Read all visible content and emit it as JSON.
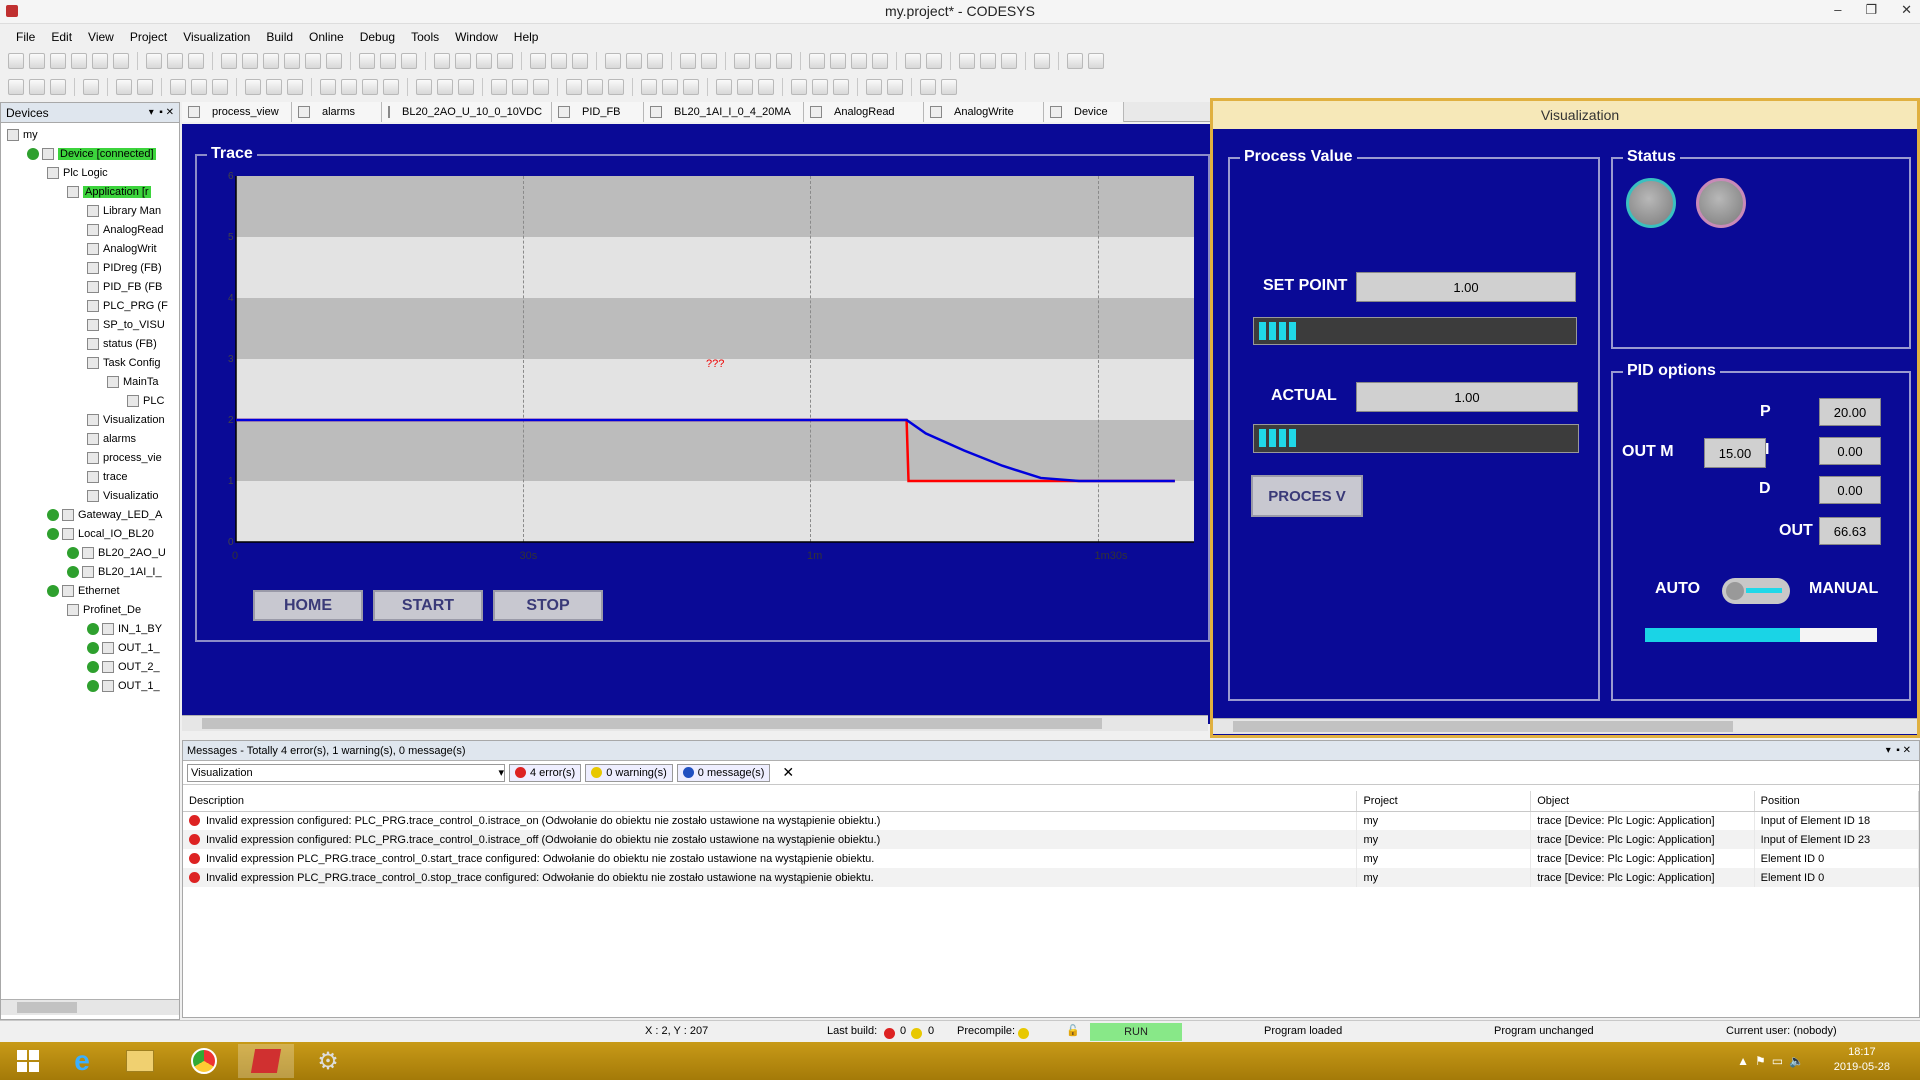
{
  "window": {
    "title": "my.project* - CODESYS"
  },
  "menu": [
    "File",
    "Edit",
    "View",
    "Project",
    "Visualization",
    "Build",
    "Online",
    "Debug",
    "Tools",
    "Window",
    "Help"
  ],
  "devices": {
    "header": "Devices",
    "tree": [
      {
        "label": "my",
        "indent": 0
      },
      {
        "label": "Device [connected]",
        "indent": 1,
        "hl": true,
        "ok": true
      },
      {
        "label": "Plc Logic",
        "indent": 2
      },
      {
        "label": "Application [r",
        "indent": 3,
        "hl": true
      },
      {
        "label": "Library Man",
        "indent": 4
      },
      {
        "label": "AnalogRead",
        "indent": 4
      },
      {
        "label": "AnalogWrit",
        "indent": 4
      },
      {
        "label": "PIDreg (FB)",
        "indent": 4
      },
      {
        "label": "PID_FB (FB",
        "indent": 4
      },
      {
        "label": "PLC_PRG (F",
        "indent": 4
      },
      {
        "label": "SP_to_VISU",
        "indent": 4
      },
      {
        "label": "status (FB)",
        "indent": 4
      },
      {
        "label": "Task Config",
        "indent": 4
      },
      {
        "label": "MainTa",
        "indent": 5
      },
      {
        "label": "PLC",
        "indent": 6
      },
      {
        "label": "Visualization",
        "indent": 4
      },
      {
        "label": "alarms",
        "indent": 4
      },
      {
        "label": "process_vie",
        "indent": 4
      },
      {
        "label": "trace",
        "indent": 4
      },
      {
        "label": "Visualizatio",
        "indent": 4
      },
      {
        "label": "Gateway_LED_A",
        "indent": 2,
        "ok": true
      },
      {
        "label": "Local_IO_BL20",
        "indent": 2,
        "ok": true
      },
      {
        "label": "BL20_2AO_U",
        "indent": 3,
        "ok": true
      },
      {
        "label": "BL20_1AI_I_",
        "indent": 3,
        "ok": true
      },
      {
        "label": "Ethernet",
        "indent": 2,
        "ok": true
      },
      {
        "label": "Profinet_De",
        "indent": 3
      },
      {
        "label": "IN_1_BY",
        "indent": 4,
        "ok": true
      },
      {
        "label": "OUT_1_",
        "indent": 4,
        "ok": true
      },
      {
        "label": "OUT_2_",
        "indent": 4,
        "ok": true
      },
      {
        "label": "OUT_1_",
        "indent": 4,
        "ok": true
      }
    ]
  },
  "tabs": [
    "process_view",
    "alarms",
    "BL20_2AO_U_10_0_10VDC",
    "PID_FB",
    "BL20_1AI_I_0_4_20MA",
    "AnalogRead",
    "AnalogWrite",
    "Device"
  ],
  "trace": {
    "title": "Trace",
    "annotation": "???",
    "buttons": {
      "home": "HOME",
      "start": "START",
      "stop": "STOP"
    }
  },
  "chart_data": {
    "type": "line",
    "x_ticks": [
      "0",
      "30s",
      "1m",
      "1m30s"
    ],
    "xlim": [
      0,
      100
    ],
    "ylim": [
      0,
      6
    ],
    "y_ticks": [
      "0",
      "1",
      "2",
      "3",
      "4",
      "5",
      "6"
    ],
    "series": [
      {
        "color": "#ff0000",
        "x": [
          0,
          70,
          70.2,
          98
        ],
        "y": [
          2,
          2,
          1,
          1
        ]
      },
      {
        "color": "#0000dd",
        "x": [
          0,
          70,
          72,
          76,
          80,
          84,
          88,
          98
        ],
        "y": [
          2,
          2,
          1.78,
          1.5,
          1.25,
          1.05,
          1,
          1
        ]
      }
    ]
  },
  "visualization": {
    "title": "Visualization",
    "process_value": {
      "title": "Process Value",
      "setpoint_label": "SET POINT",
      "setpoint_value": "1.00",
      "actual_label": "ACTUAL",
      "actual_value": "1.00",
      "button": "PROCES V"
    },
    "status": {
      "title": "Status"
    },
    "pid": {
      "title": "PID options",
      "p_label": "P",
      "p_value": "20.00",
      "i_label": "I",
      "i_value": "0.00",
      "d_label": "D",
      "d_value": "0.00",
      "outm_label": "OUT M",
      "outm_value": "15.00",
      "out_label": "OUT",
      "out_value": "66.63",
      "auto_label": "AUTO",
      "manual_label": "MANUAL",
      "output_fraction": 0.67
    }
  },
  "messages": {
    "header": "Messages - Totally 4 error(s), 1 warning(s), 0 message(s)",
    "filter": "Visualization",
    "errors_btn": "4 error(s)",
    "warnings_btn": "0 warning(s)",
    "messages_btn": "0 message(s)",
    "columns": [
      "Description",
      "Project",
      "Object",
      "Position"
    ],
    "rows": [
      {
        "desc": "Invalid expression configured: PLC_PRG.trace_control_0.istrace_on (Odwołanie do obiektu nie zostało ustawione na wystąpienie obiektu.)",
        "project": "my",
        "object": "trace [Device: Plc Logic: Application]",
        "position": "Input of Element ID 18"
      },
      {
        "desc": "Invalid expression configured: PLC_PRG.trace_control_0.istrace_off (Odwołanie do obiektu nie zostało ustawione na wystąpienie obiektu.)",
        "project": "my",
        "object": "trace [Device: Plc Logic: Application]",
        "position": "Input of Element ID 23"
      },
      {
        "desc": "Invalid expression PLC_PRG.trace_control_0.start_trace configured: Odwołanie do obiektu nie zostało ustawione na wystąpienie obiektu.",
        "project": "my",
        "object": "trace [Device: Plc Logic: Application]",
        "position": "Element ID 0"
      },
      {
        "desc": "Invalid expression PLC_PRG.trace_control_0.stop_trace configured: Odwołanie do obiektu nie zostało ustawione na wystąpienie obiektu.",
        "project": "my",
        "object": "trace [Device: Plc Logic: Application]",
        "position": "Element ID 0"
      }
    ]
  },
  "statusbar": {
    "coords": "X : 2, Y : 207",
    "last_build": "Last build:",
    "build_errors": "0",
    "build_warnings": "0",
    "precompile": "Precompile:",
    "run": "RUN",
    "program_loaded": "Program loaded",
    "program_unchanged": "Program unchanged",
    "current_user": "Current user: (nobody)"
  },
  "taskbar": {
    "time": "18:17",
    "date": "2019-05-28"
  }
}
